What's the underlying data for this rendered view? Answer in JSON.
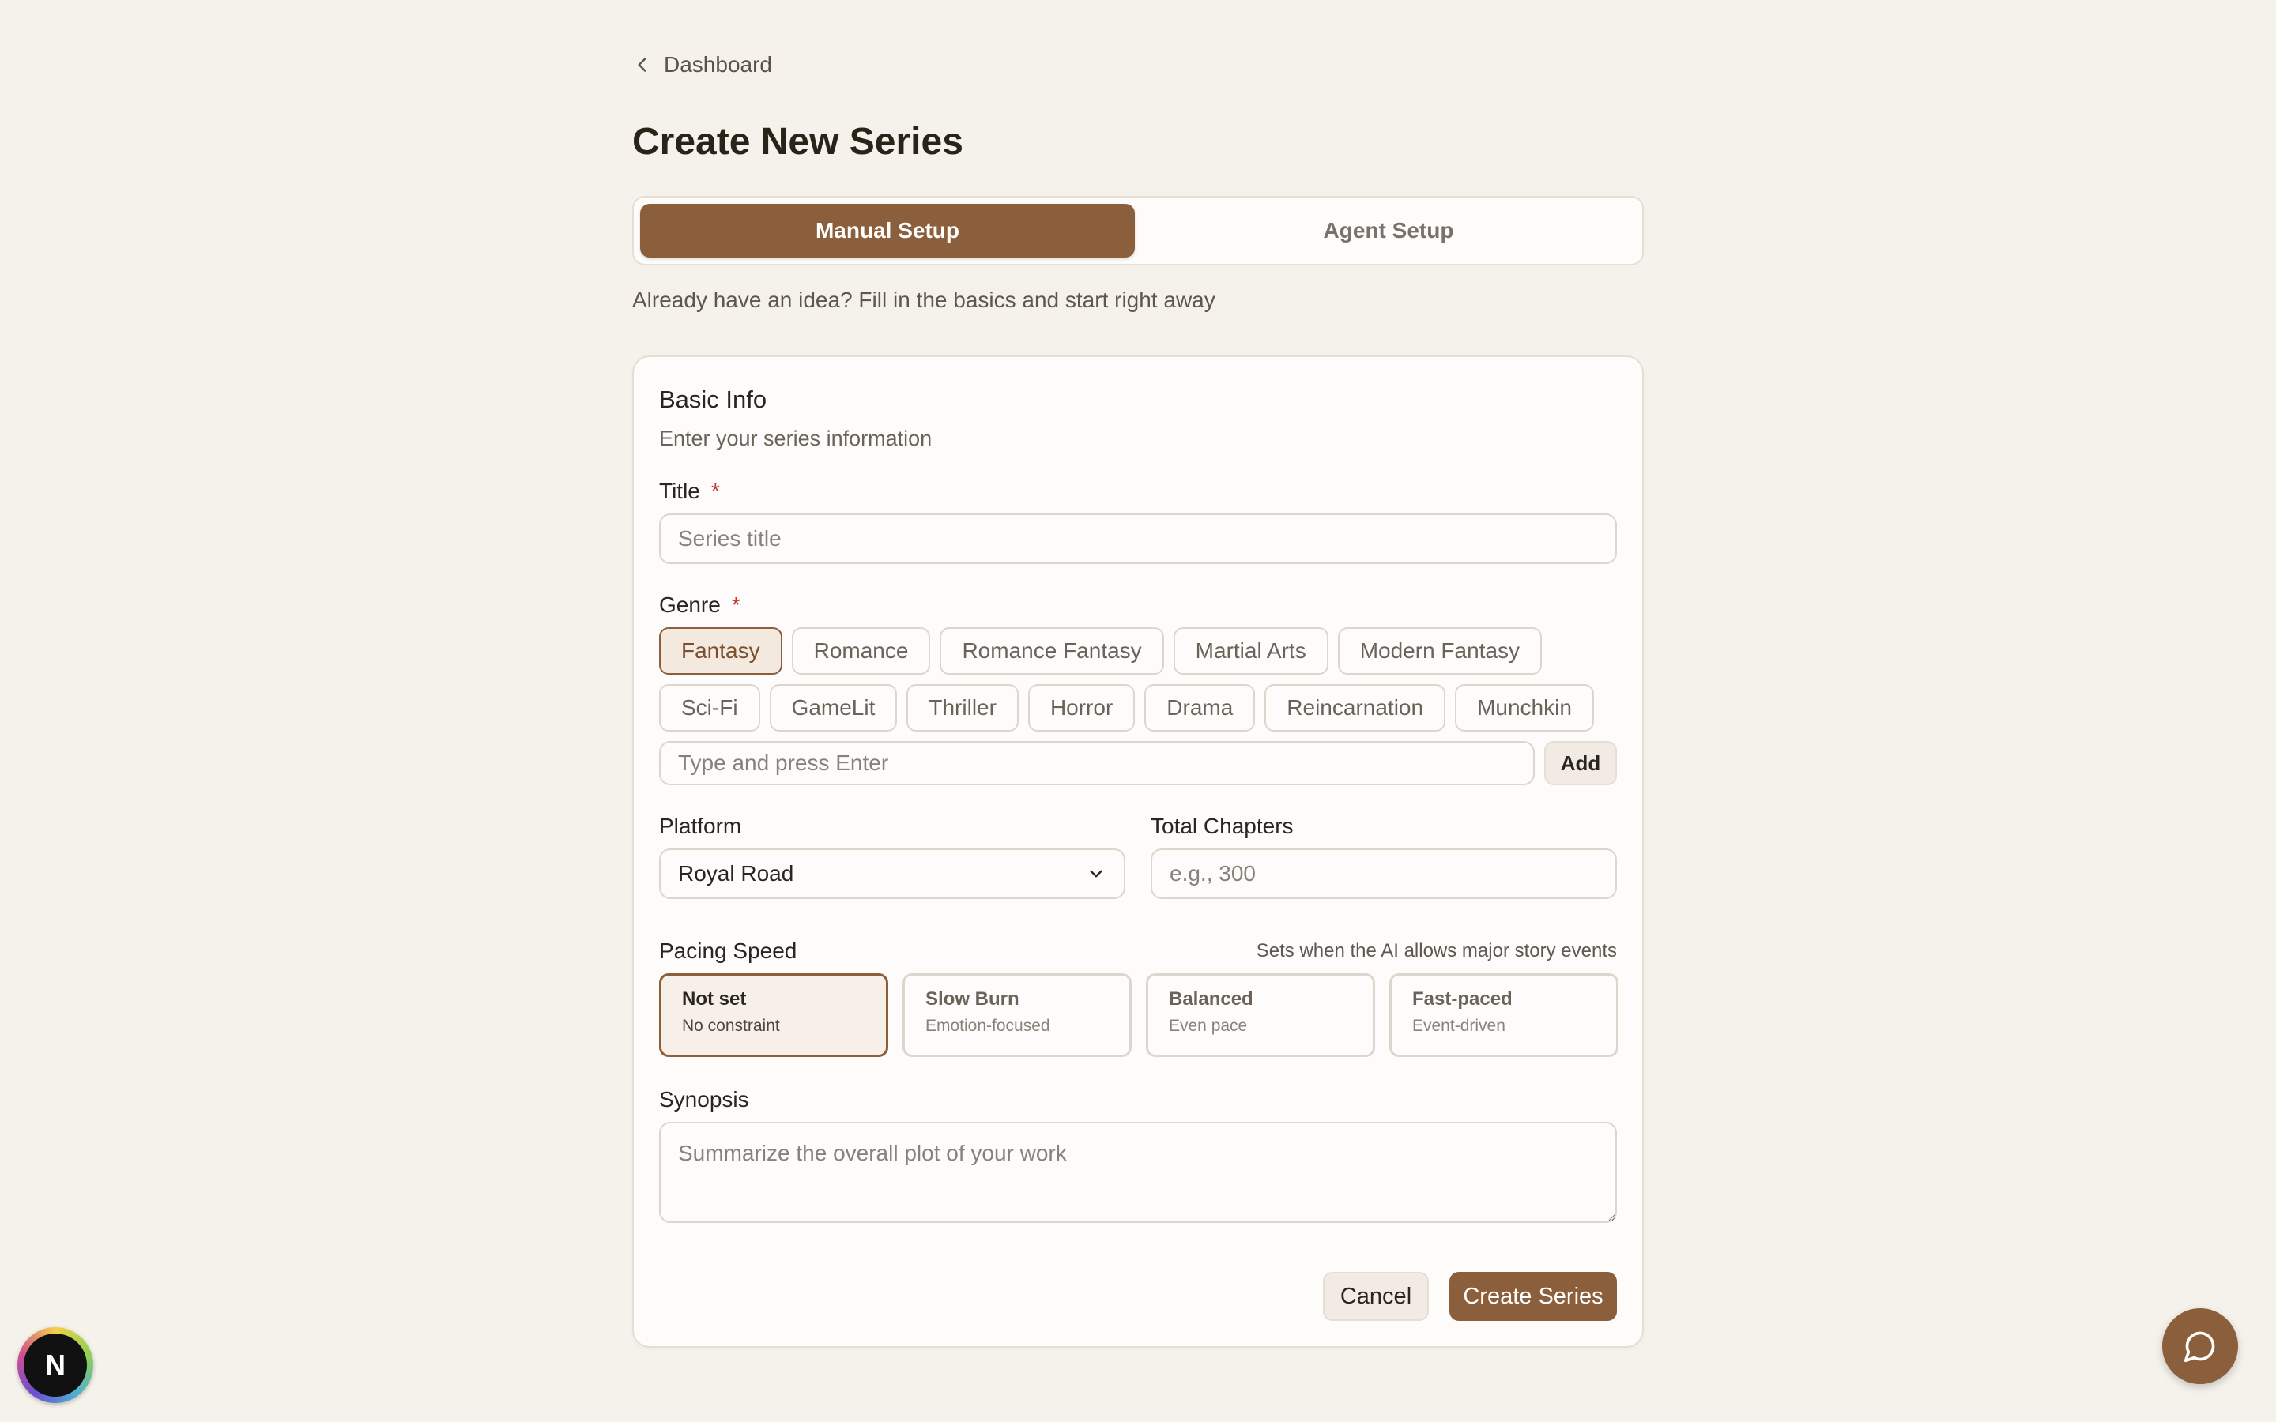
{
  "nav": {
    "back_label": "Dashboard"
  },
  "page": {
    "title": "Create New Series",
    "tabs": [
      {
        "label": "Manual Setup",
        "active": true
      },
      {
        "label": "Agent Setup",
        "active": false
      }
    ],
    "tab_description": "Already have an idea? Fill in the basics and start right away"
  },
  "card": {
    "title": "Basic Info",
    "description": "Enter your series information",
    "title_field": {
      "label": "Title",
      "required_mark": "*",
      "placeholder": "Series title",
      "value": ""
    },
    "genre": {
      "label": "Genre",
      "required_mark": "*",
      "options": [
        "Fantasy",
        "Romance",
        "Romance Fantasy",
        "Martial Arts",
        "Modern Fantasy",
        "Sci-Fi",
        "GameLit",
        "Thriller",
        "Horror",
        "Drama",
        "Reincarnation",
        "Munchkin"
      ],
      "selected": "Fantasy",
      "custom_placeholder": "Type and press Enter",
      "add_label": "Add"
    },
    "platform": {
      "label": "Platform",
      "value": "Royal Road"
    },
    "total_chapters": {
      "label": "Total Chapters",
      "placeholder": "e.g., 300"
    },
    "pacing": {
      "label": "Pacing Speed",
      "hint": "Sets when the AI allows major story events",
      "options": [
        {
          "title": "Not set",
          "subtitle": "No constraint"
        },
        {
          "title": "Slow Burn",
          "subtitle": "Emotion-focused"
        },
        {
          "title": "Balanced",
          "subtitle": "Even pace"
        },
        {
          "title": "Fast-paced",
          "subtitle": "Event-driven"
        }
      ],
      "selected": "Not set"
    },
    "synopsis": {
      "label": "Synopsis",
      "placeholder": "Summarize the overall plot of your work"
    },
    "actions": {
      "cancel_label": "Cancel",
      "create_label": "Create Series"
    }
  },
  "avatar": {
    "initial": "N"
  },
  "colors": {
    "accent": "#8b5e3c",
    "background": "#f5f1eb",
    "card": "#fdfcfa",
    "required": "#c0392b"
  }
}
